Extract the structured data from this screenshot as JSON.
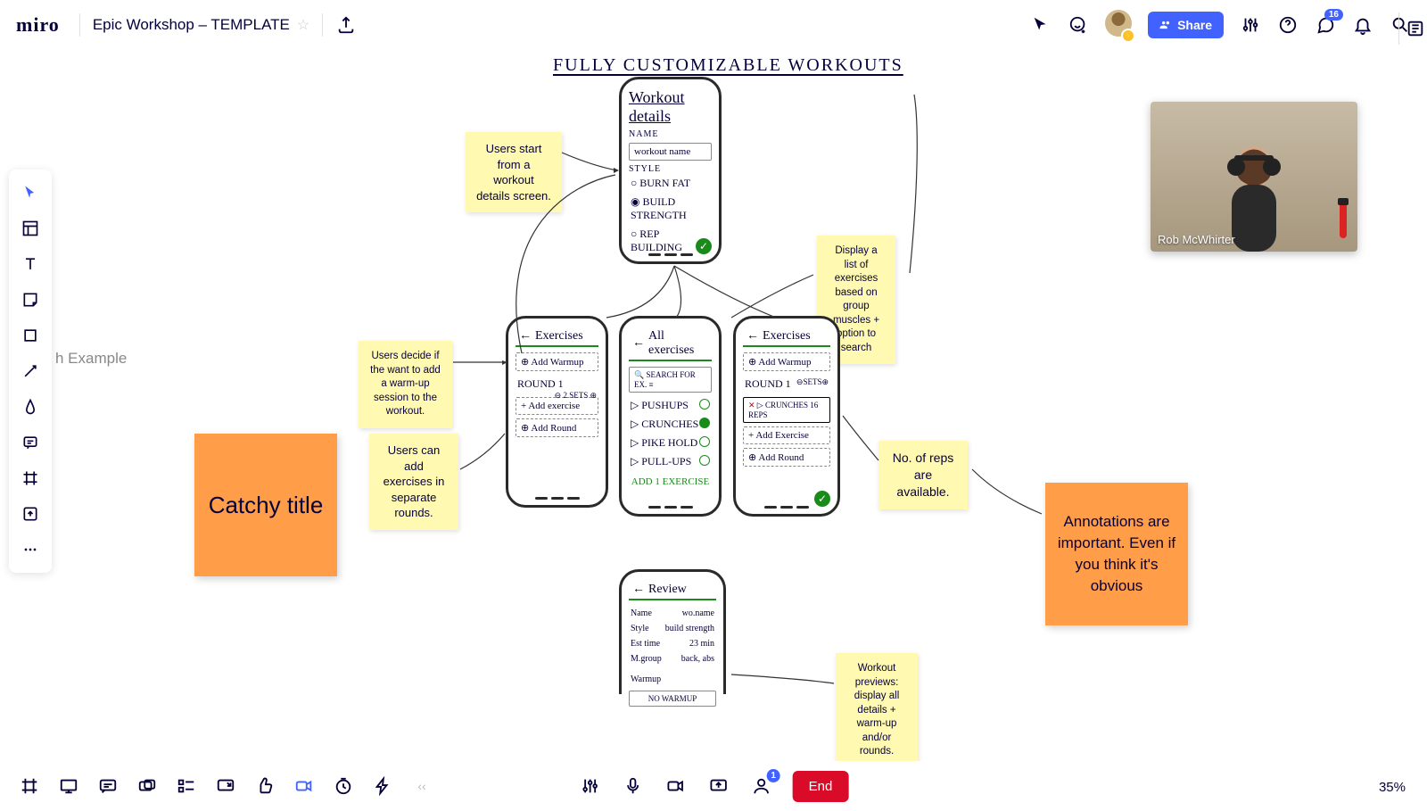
{
  "header": {
    "logo": "miro",
    "board_title": "Epic Workshop – TEMPLATE",
    "share_label": "Share",
    "comment_badge": "16"
  },
  "canvas": {
    "frame_label": "h Example",
    "sketch_heading": "FULLY   CUSTOMIZABLE   WORKOUTS"
  },
  "stickies": {
    "start": "Users start from a workout details screen.",
    "list": "Display a list of exercises based on group muscles + option to search",
    "warmup": "Users decide if the want to add a warm-up session to the workout.",
    "rounds": "Users can add exercises in separate rounds.",
    "catchy": "Catchy title",
    "reps": "No. of reps are available.",
    "annotations": "Annotations are important. Even if you think it's obvious",
    "previews": "Workout previews: display all details + warm-up and/or rounds."
  },
  "phones": {
    "p1": {
      "title": "Workout details",
      "name_label": "NAME",
      "name_value": "workout name",
      "style_label": "STYLE",
      "opt1": "BURN FAT",
      "opt2": "BUILD STRENGTH",
      "opt3": "REP BUILDING"
    },
    "p2": {
      "title": "Exercises",
      "add_warmup": "Add Warmup",
      "round": "ROUND 1",
      "sets": "2 SETS",
      "add_ex": "+ Add exercise",
      "add_round": "Add Round"
    },
    "p3": {
      "title": "All exercises",
      "search": "SEARCH FOR EX.",
      "i1": "PUSHUPS",
      "i2": "CRUNCHES",
      "i3": "PIKE HOLD",
      "i4": "PULL-UPS",
      "footer": "ADD 1 EXERCISE"
    },
    "p4": {
      "title": "Exercises",
      "add_warmup": "Add Warmup",
      "round": "ROUND 1",
      "sets": "SETS",
      "crunches": "CRUNCHES 16 REPS",
      "add_ex": "+ Add Exercise",
      "add_round": "Add Round"
    },
    "p5": {
      "title": "Review",
      "l1a": "Name",
      "l1b": "wo.name",
      "l2a": "Style",
      "l2b": "build strength",
      "l3a": "Est time",
      "l3b": "23 min",
      "l4a": "M.group",
      "l4b": "back, abs",
      "warm_label": "Warmup",
      "warm_val": "NO WARMUP"
    }
  },
  "video": {
    "name": "Rob McWhirter"
  },
  "bottom": {
    "end_label": "End",
    "participant_count": "1",
    "zoom": "35%"
  }
}
